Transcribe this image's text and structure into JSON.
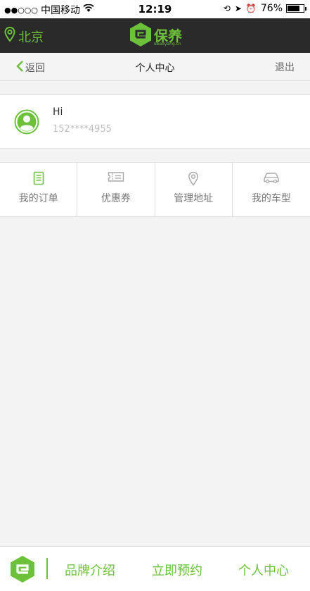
{
  "status_bar": {
    "carrier": "中国移动",
    "time": "12:19",
    "battery": "76%",
    "battery_level": 0.76
  },
  "app_bar": {
    "city": "北京",
    "logo_text": "保养",
    "logo_sub": "ebaoyang.cn",
    "accent_color": "#6cc03a"
  },
  "nav": {
    "back_label": "返回",
    "title": "个人中心",
    "logout_label": "退出"
  },
  "profile": {
    "greeting": "Hi",
    "phone": "152****4955"
  },
  "menu": {
    "items": [
      {
        "label": "我的订单",
        "icon": "order-icon"
      },
      {
        "label": "优惠券",
        "icon": "coupon-icon"
      },
      {
        "label": "管理地址",
        "icon": "location-pin-icon"
      },
      {
        "label": "我的车型",
        "icon": "car-icon"
      }
    ]
  },
  "tab_bar": {
    "tabs": [
      {
        "label": "品牌介绍"
      },
      {
        "label": "立即预约"
      },
      {
        "label": "个人中心"
      }
    ]
  }
}
